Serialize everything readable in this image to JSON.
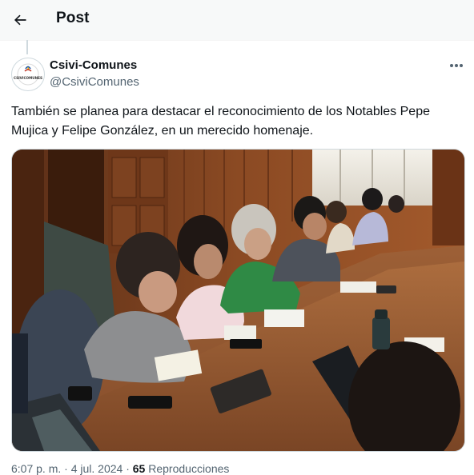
{
  "header": {
    "back_icon": "arrow-left-icon",
    "title": "Post"
  },
  "author": {
    "display_name": "Csivi-Comunes",
    "handle": "@CsiviComunes",
    "avatar_text": "CSIVICOMUNES"
  },
  "more_icon": "more-horizontal-icon",
  "tweet": {
    "text": "También se planea para destacar el reconocimiento de los Notables Pepe Mujica y Felipe González, en un merecido homenaje."
  },
  "media": {
    "kind": "photo"
  },
  "footer": {
    "timestamp": "6:07 p. m. · 4 jul. 2024",
    "reposts_count": "65",
    "reposts_label": "Reproducciones"
  },
  "colors": {
    "text": "#0f1419",
    "secondary": "#536471",
    "header_bg": "#f7f9f9",
    "border": "#cfd9de"
  }
}
